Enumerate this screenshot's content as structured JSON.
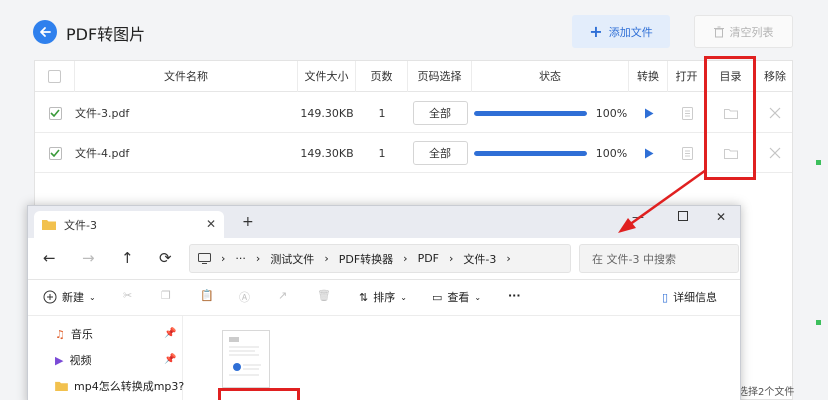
{
  "app": {
    "title": "PDF转图片",
    "add_btn": "添加文件",
    "clear_btn": "清空列表",
    "columns": [
      "文件名称",
      "文件大小",
      "页数",
      "页码选择",
      "状态",
      "转换",
      "打开",
      "目录",
      "移除"
    ],
    "rows": [
      {
        "name": "文件-3.pdf",
        "size": "149.30KB",
        "pages": "1",
        "page_select": "全部",
        "progress": 1.0,
        "pct": "100%"
      },
      {
        "name": "文件-4.pdf",
        "size": "149.30KB",
        "pages": "1",
        "page_select": "全部",
        "progress": 1.0,
        "pct": "100%"
      }
    ],
    "status_text": "选择2个文件",
    "colors": {
      "accent": "#2f6fd6",
      "annotation": "#e02020"
    }
  },
  "explorer": {
    "tab_title": "文件-3",
    "breadcrumb": [
      "测试文件",
      "PDF转换器",
      "PDF",
      "文件-3"
    ],
    "search_placeholder": "在 文件-3 中搜索",
    "new_label": "新建",
    "sort_label": "排序",
    "view_label": "查看",
    "details_label": "详细信息",
    "sidebar": [
      {
        "label": "音乐",
        "icon": "music-icon"
      },
      {
        "label": "视频",
        "icon": "video-icon"
      },
      {
        "label": "mp4怎么转换成mp3?",
        "icon": "folder-icon"
      }
    ]
  }
}
